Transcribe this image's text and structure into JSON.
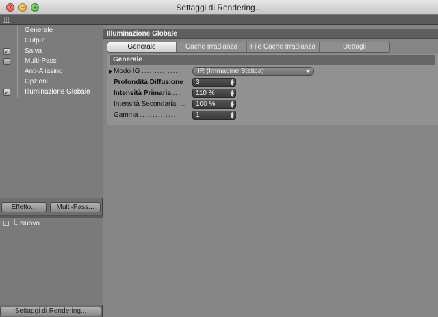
{
  "window": {
    "title": "Settaggi di Rendering...",
    "controls": [
      "close-icon",
      "minimize-icon",
      "zoom-icon"
    ]
  },
  "sidebar": {
    "items": [
      {
        "label": "Generale",
        "checkbox": null
      },
      {
        "label": "Output",
        "checkbox": null
      },
      {
        "label": "Salva",
        "checkbox": "checked"
      },
      {
        "label": "Multi-Pass",
        "checkbox": "unchecked"
      },
      {
        "label": "Anti-Aliasing",
        "checkbox": null
      },
      {
        "label": "Opzioni",
        "checkbox": null
      },
      {
        "label": "Illuminazione Globale",
        "checkbox": "checked",
        "selected": true
      }
    ],
    "buttons": {
      "effetto": "Effetto...",
      "multipass": "Multi-Pass..."
    },
    "effects": {
      "item": "Nuovo"
    },
    "render_settings_button": "Settaggi di Rendering..."
  },
  "main": {
    "header": "Illuminazione Globale",
    "tabs": [
      {
        "label": "Generale",
        "active": true
      },
      {
        "label": "Cache Irradianza",
        "active": false
      },
      {
        "label": "File Cache Irradianza",
        "active": false
      },
      {
        "label": "Dettagli",
        "active": false
      }
    ],
    "section": "Generale",
    "fields": {
      "modo_ig": {
        "label": "Modo IG",
        "dots": "...............",
        "value": "IR (Immagine Statica)"
      },
      "profondita": {
        "label": "Profondità Diffusione",
        "value": "3"
      },
      "intensita_primaria": {
        "label": "Intensità Primaria",
        "dots": "...",
        "value": "110 %"
      },
      "intensita_secondaria": {
        "label": "Intensità Secondaria",
        "dots": "...",
        "value": "100 %"
      },
      "gamma": {
        "label": "Gamma",
        "dots": "...............",
        "value": "1"
      }
    }
  },
  "colors": {
    "sidebar_bg": "#7c7c7c",
    "main_bg": "#858585",
    "header_bg": "#5e5e5e",
    "field_bg": "#454545",
    "active_tab": "#e2e2e2"
  }
}
